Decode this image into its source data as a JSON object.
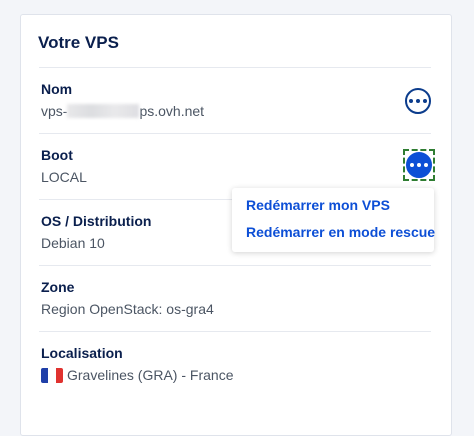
{
  "card": {
    "title": "Votre VPS"
  },
  "rows": [
    {
      "label": "Nom",
      "value_prefix": "vps-",
      "value_suffix": "ps.ovh.net"
    },
    {
      "label": "Boot",
      "value": "LOCAL"
    },
    {
      "label": "OS / Distribution",
      "value": "Debian 10"
    },
    {
      "label": "Zone",
      "value": "Region OpenStack: os-gra4"
    },
    {
      "label": "Localisation",
      "value": "Gravelines (GRA) - France"
    }
  ],
  "menu": {
    "items": [
      "Redémarrer mon VPS",
      "Redémarrer en mode rescue"
    ]
  },
  "icons": {
    "more": "more-options-icon",
    "flag": "flag-france-icon"
  },
  "colors": {
    "accent": "#0d4fd6",
    "navy": "#0a1f4d",
    "focus": "#2f7d32",
    "flag_blue": "#1f3fa8",
    "flag_white": "#ffffff",
    "flag_red": "#e0322f"
  }
}
